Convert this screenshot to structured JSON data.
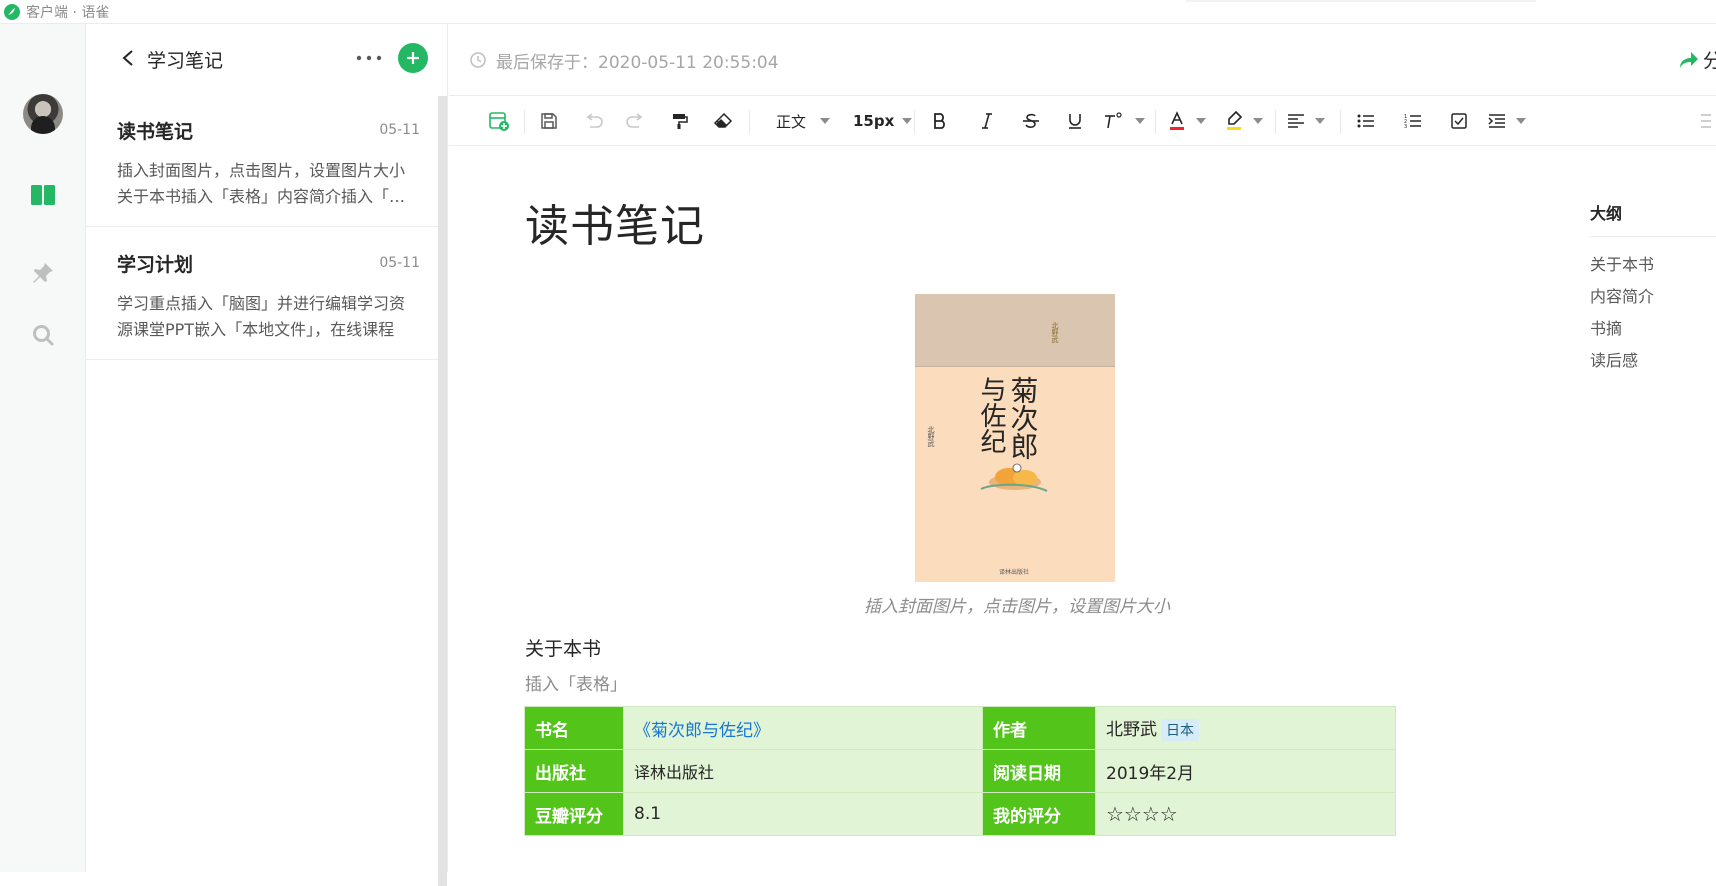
{
  "window": {
    "title": "客户端 · 语雀"
  },
  "sidebar": {
    "book_title": "学习笔记",
    "docs": [
      {
        "title": "读书笔记",
        "date": "05-11",
        "summary": "插入封面图片，点击图片，设置图片大小关于本书插入「表格」内容简介插入「引用」书摘"
      },
      {
        "title": "学习计划",
        "date": "05-11",
        "summary": "学习重点插入「脑图」并进行编辑学习资源课堂PPT嵌入「本地文件」，在线课程"
      }
    ]
  },
  "editor": {
    "saved_at": "最后保存于：2020-05-11 20:55:04",
    "share_label": "分",
    "toolbar": {
      "paragraph": "正文",
      "font_size": "15px"
    },
    "doc_title": "读书笔记",
    "cover_caption": "插入封面图片，点击图片，设置图片大小",
    "cover": {
      "title_a": "菊次郎",
      "title_b": "与佐纪",
      "author": "北野武",
      "publisher": "译林出版社"
    },
    "section_title": "关于本书",
    "section_hint": "插入「表格」",
    "table": {
      "rows": [
        {
          "k1": "书名",
          "v1": "《菊次郎与佐纪》",
          "k2": "作者",
          "v2": "北野武",
          "v2_tag": "日本"
        },
        {
          "k1": "出版社",
          "v1": "译林出版社",
          "k2": "阅读日期",
          "v2": "2019年2月"
        },
        {
          "k1": "豆瓣评分",
          "v1": "8.1",
          "k2": "我的评分",
          "v2": "☆☆☆☆"
        }
      ]
    },
    "outline": {
      "title": "大纲",
      "items": [
        "关于本书",
        "内容简介",
        "书摘",
        "读后感"
      ]
    }
  },
  "colors": {
    "brand": "#25b864",
    "table_key": "#52c41a",
    "table_value": "#e2f4d6",
    "link": "#1677d2"
  }
}
